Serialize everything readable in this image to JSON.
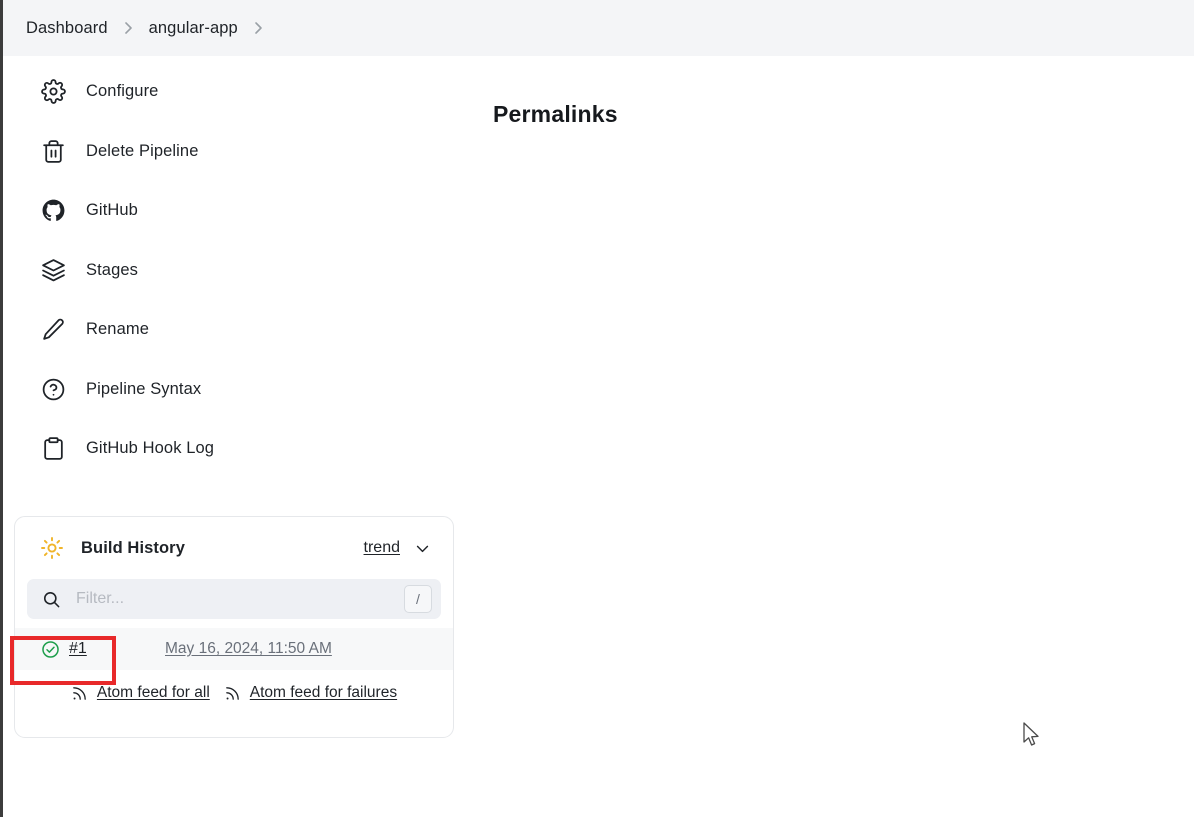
{
  "breadcrumb": {
    "items": [
      {
        "label": "Dashboard"
      },
      {
        "label": "angular-app"
      }
    ]
  },
  "sidebar": {
    "items": [
      {
        "label": "Configure",
        "icon": "gear-icon"
      },
      {
        "label": "Delete Pipeline",
        "icon": "trash-icon"
      },
      {
        "label": "GitHub",
        "icon": "github-icon"
      },
      {
        "label": "Stages",
        "icon": "layers-icon"
      },
      {
        "label": "Rename",
        "icon": "pencil-icon"
      },
      {
        "label": "Pipeline Syntax",
        "icon": "question-circle-icon"
      },
      {
        "label": "GitHub Hook Log",
        "icon": "clipboard-icon"
      }
    ]
  },
  "build_history": {
    "title": "Build History",
    "weather_icon": "sun-icon",
    "trend_label": "trend",
    "chevron_icon": "chevron-down-icon",
    "filter": {
      "placeholder": "Filter...",
      "value": "",
      "search_icon": "search-icon",
      "shortcut_key": "/"
    },
    "builds": [
      {
        "status_icon": "check-circle-icon",
        "status_color": "#1d9e4b",
        "number": "#1",
        "timestamp": "May 16, 2024, 11:50 AM"
      }
    ],
    "feeds": [
      {
        "label": "Atom feed for all",
        "icon": "rss-icon"
      },
      {
        "label": "Atom feed for failures",
        "icon": "rss-icon"
      }
    ]
  },
  "main": {
    "heading": "Permalinks"
  },
  "annotation": {
    "color": "#e8292a"
  }
}
